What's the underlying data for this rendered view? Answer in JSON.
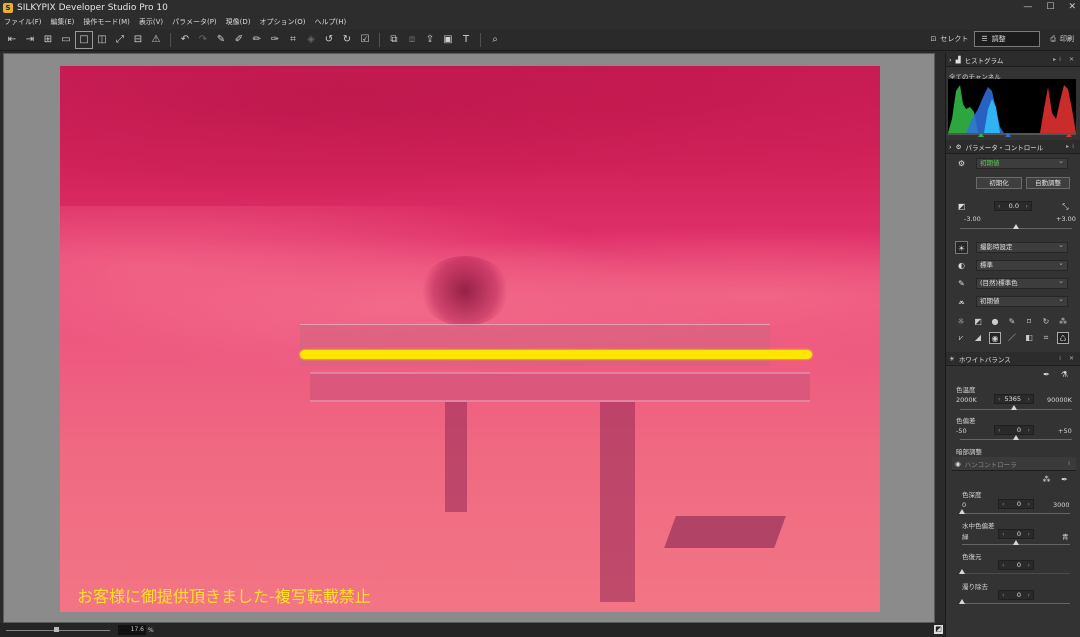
{
  "window": {
    "title": "SILKYPIX Developer Studio Pro 10",
    "minimize_glyph": "—",
    "maximize_glyph": "☐",
    "close_glyph": "✕"
  },
  "menu": [
    "ファイル(F)",
    "編集(E)",
    "操作モード(M)",
    "表示(V)",
    "パラメータ(P)",
    "現像(D)",
    "オプション(O)",
    "ヘルプ(H)"
  ],
  "toolbar": {
    "modes": {
      "select": "セレクト",
      "adjust": "調整",
      "print": "印刷"
    }
  },
  "photo": {
    "watermark": "お客様に御提供頂きました-複写転載禁止",
    "highlight_color": "#ffe600"
  },
  "status": {
    "zoom": "17.6",
    "zoom_unit": "%"
  },
  "panel": {
    "histogram": {
      "title": "ヒストグラム",
      "channel": "全てのチャンネル"
    },
    "params": {
      "title": "パラメータ・コントロール",
      "preset": "初期値",
      "reset_btn": "初期化",
      "auto_btn": "自動調整",
      "exposure": {
        "value": "0.0",
        "min": "-3.00",
        "max": "+3.00",
        "level": 0.5
      },
      "dropdowns": [
        "撮影時設定",
        "標準",
        "(目然)標準色",
        "初期値"
      ]
    },
    "wb": {
      "title": "ホワイトバランス",
      "temp_label": "色温度",
      "temp_min": "2000K",
      "temp_value": "5365",
      "temp_max": "90000K",
      "temp_level": 0.48,
      "tint_label": "色偏差",
      "tint_min": "-50",
      "tint_value": "0",
      "tint_max": "+50",
      "tint_level": 0.5
    },
    "dark": {
      "title": "暗部調整",
      "sub_title": "ハンコントローラ",
      "depth_label": "色深度",
      "depth_min": "0",
      "depth_value": "0",
      "depth_max": "3000",
      "depth_level": 0.0,
      "water_label": "水中色偏差",
      "water_min": "緑",
      "water_value": "0",
      "water_max": "青",
      "water_level": 0.5,
      "restore_label": "色復元",
      "restore_value": "0",
      "restore_level": 0.0,
      "haze_label": "濁り除去",
      "haze_value": "0",
      "haze_level": 0.0
    }
  }
}
